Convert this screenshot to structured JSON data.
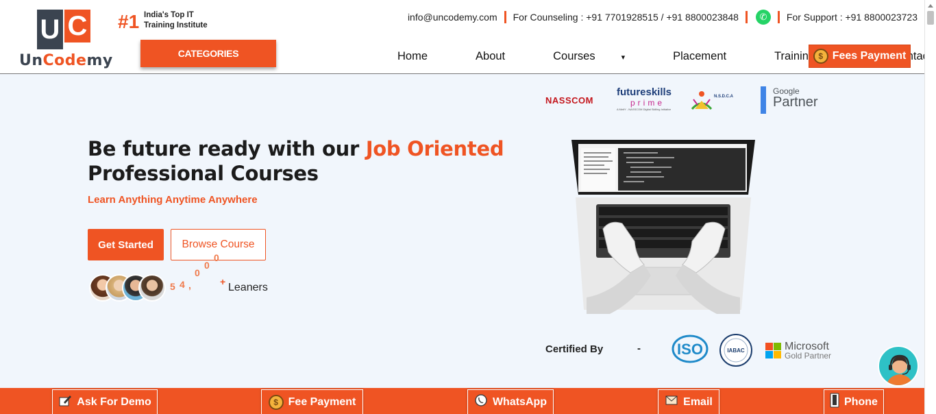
{
  "header": {
    "logo_mark_u": "U",
    "logo_mark_c": "C",
    "logo_name_a": "Un",
    "logo_name_b": "Code",
    "logo_name_c": "my",
    "rank": "#1",
    "rank_text_1": "India's Top IT",
    "rank_text_2": "Training Institute",
    "categories_label": "CATEGORIES",
    "email": "info@uncodemy.com",
    "counseling": "For Counseling : +91 7701928515 / +91 8800023848",
    "support": "For Support : +91 8800023723",
    "nav": [
      {
        "label": "Home"
      },
      {
        "label": "About"
      },
      {
        "label": "Courses",
        "caret": "▾"
      },
      {
        "label": "Placement"
      },
      {
        "label": "Training",
        "caret": "▾"
      },
      {
        "label": "Contact"
      }
    ],
    "fees_label": "Fees Payment",
    "coin_symbol": "$"
  },
  "partners": {
    "nasscom": "NASSCOM",
    "futureskills_a": "futureskills",
    "futureskills_b": "prime",
    "futureskills_c": "A MeitY - NASSCOM Digital Skilling Initiative",
    "nsdca": "N.S.D.C.A",
    "google_a": "Google",
    "google_b": "Partner"
  },
  "hero": {
    "line1_a": "Be future ready with our ",
    "line1_b": "Job Oriented",
    "line2": "Professional Courses",
    "subtitle": "Learn Anything Anytime Anywhere",
    "get_started": "Get Started",
    "browse": "Browse Course",
    "count_digits": [
      "5",
      "4",
      ",",
      "0",
      "0",
      "0",
      "+"
    ],
    "learners_label": "Leaners"
  },
  "certified": {
    "label": "Certified By",
    "dash": "-",
    "iso": "ISO",
    "iabac": "IABAC",
    "ms_1": "Microsoft",
    "ms_2": "Gold Partner"
  },
  "bottom_bar": {
    "demo": "Ask For Demo",
    "fee": "Fee Payment",
    "whatsapp": "WhatsApp",
    "email": "Email",
    "phone": "Phone"
  },
  "colors": {
    "accent": "#ef5423",
    "dark": "#3b4450",
    "background": "#f1f6fc"
  }
}
